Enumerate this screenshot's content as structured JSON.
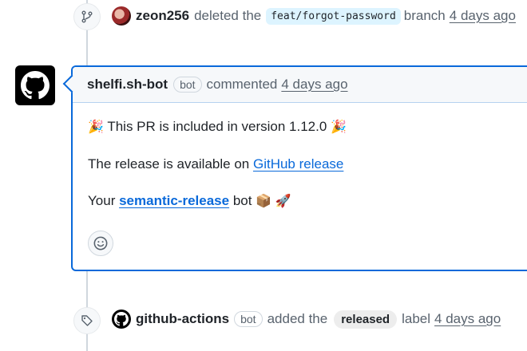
{
  "event_deleted": {
    "username": "zeon256",
    "text": "deleted the",
    "branch": "feat/forgot-password",
    "suffix": "branch",
    "time": "4 days ago"
  },
  "comment": {
    "author": "shelfi.sh-bot",
    "badge": "bot",
    "action": "commented",
    "time": "4 days ago",
    "line1_emoji_left": "🎉",
    "line1_text": "This PR is included in version 1.12.0",
    "line1_emoji_right": "🎉",
    "line2_text": "The release is available on",
    "line2_link": "GitHub release",
    "line3_prefix": "Your",
    "line3_link": "semantic-release",
    "line3_suffix": "bot",
    "line3_emoji_1": "📦",
    "line3_emoji_2": "🚀"
  },
  "event_label": {
    "username": "github-actions",
    "badge": "bot",
    "text": "added the",
    "label": "released",
    "suffix": "label",
    "time": "4 days ago"
  },
  "icons": [
    "git-branch-icon",
    "github-octocat-icon",
    "smiley-icon",
    "tag-icon"
  ]
}
